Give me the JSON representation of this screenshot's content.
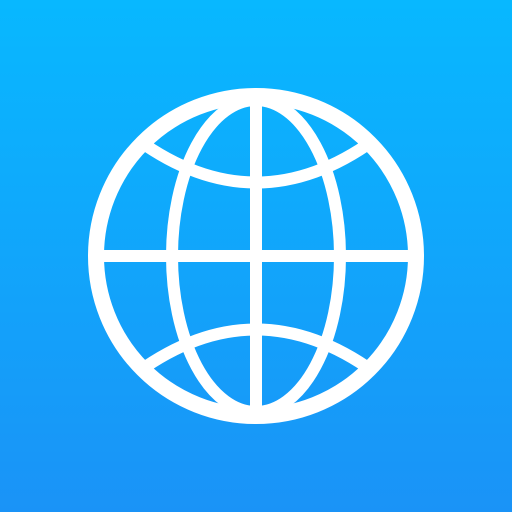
{
  "app_icon": {
    "icon": "globe-icon",
    "colors": {
      "background_top": "#08b8ff",
      "background_bottom": "#1a93f7",
      "glyph": "#ffffff"
    }
  }
}
